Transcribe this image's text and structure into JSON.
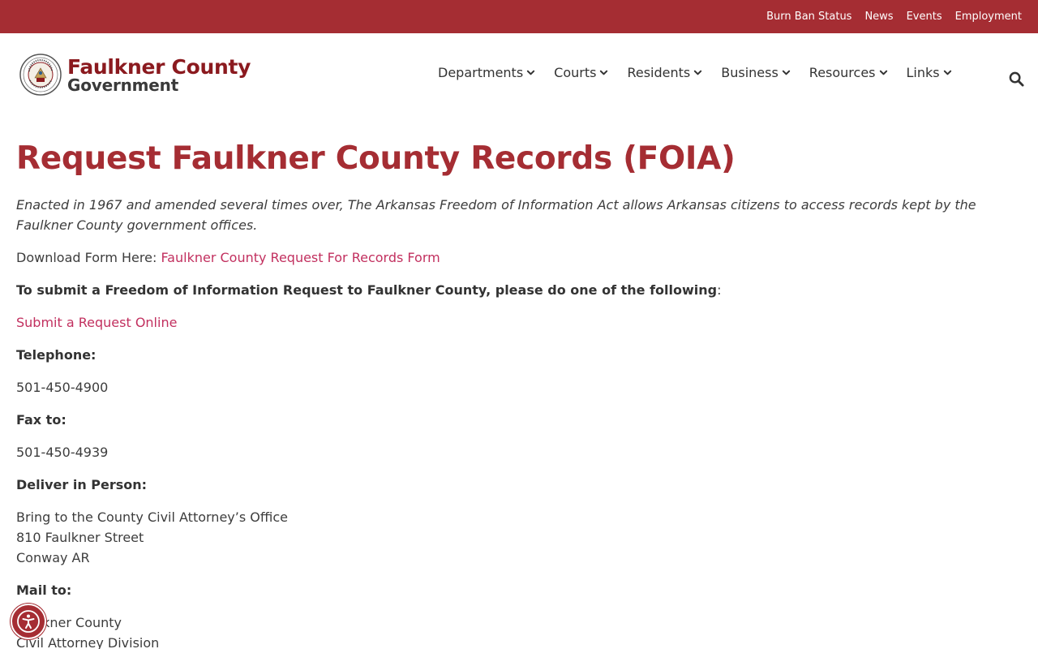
{
  "topbar": {
    "links": [
      "Burn Ban Status",
      "News",
      "Events",
      "Employment"
    ]
  },
  "logo": {
    "line1": "Faulkner County",
    "line2": "Government"
  },
  "nav": {
    "items": [
      "Departments",
      "Courts",
      "Residents",
      "Business",
      "Resources",
      "Links"
    ]
  },
  "page": {
    "title": "Request Faulkner County Records (FOIA)",
    "intro": " Enacted in 1967 and amended several times over, The Arkansas Freedom of Information Act allows Arkansas citizens to access records kept by the Faulkner County government offices.",
    "download_label": "Download Form Here: ",
    "download_link": "Faulkner County Request For Records Form",
    "submit_instructions": "To submit a Freedom of Information Request to Faulkner County, please do one of the following",
    "submit_instructions_suffix": ":",
    "online_link": "Submit a Request Online",
    "telephone_label": "Telephone:",
    "telephone": "501-450-4900",
    "fax_label": "Fax to:",
    "fax": "501-450-4939",
    "deliver_label": "Deliver in Person:",
    "deliver_line1": "Bring to the County Civil Attorney’s Office",
    "deliver_line2": "810 Faulkner Street",
    "deliver_line3": "Conway AR",
    "mail_label": "Mail to:",
    "mail_line1": "Faulkner County",
    "mail_line2": "Civil Attorney Division"
  },
  "colors": {
    "brand": "#a52d33",
    "logo_red": "#8b1a1f",
    "link": "#c2305f"
  },
  "icons": {
    "search": "search-icon",
    "chevron": "chevron-down-icon",
    "accessibility": "accessibility-icon"
  }
}
